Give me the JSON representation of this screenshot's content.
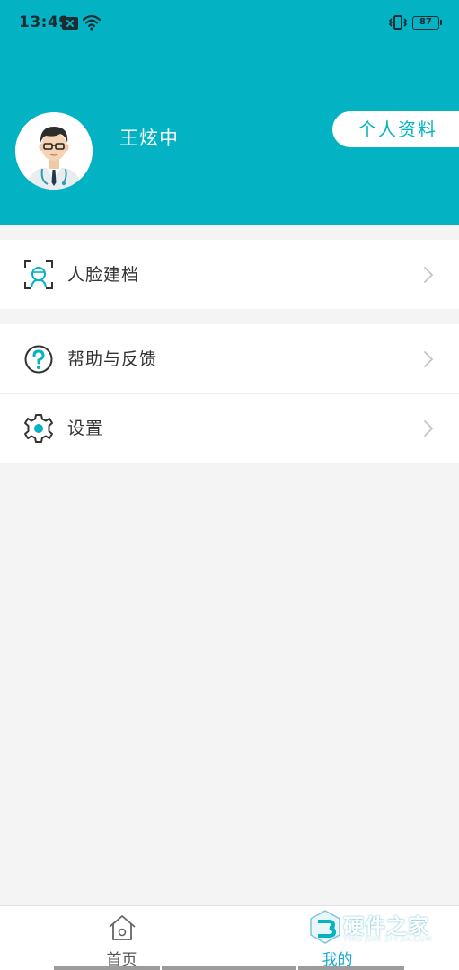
{
  "status_bar": {
    "time": "13:49",
    "battery": "87",
    "icons": [
      "sim-x-icon",
      "wifi-icon",
      "vibrate-icon",
      "battery-icon"
    ]
  },
  "profile": {
    "name": "王炫中",
    "profile_button": "个人资料",
    "avatar": "doctor-avatar"
  },
  "menu": {
    "face_archive": "人脸建档",
    "help_feedback": "帮助与反馈",
    "settings": "设置"
  },
  "tabbar": {
    "home": "首页",
    "mine": "我的",
    "active": "mine"
  },
  "watermark": {
    "brand": "硬件之家",
    "sub": "YING JIAN ZHI JIA.COM"
  },
  "colors": {
    "primary": "#03b3c3",
    "active_tab": "#1ba7d6",
    "background": "#f4f4f4"
  }
}
